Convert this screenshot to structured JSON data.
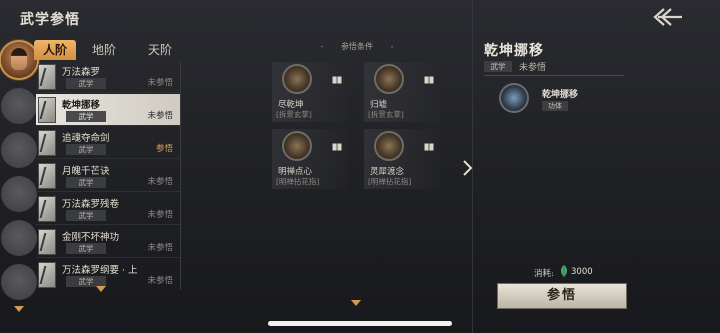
{
  "header": {
    "title": "武学参悟"
  },
  "tabs": [
    {
      "label": "人阶",
      "active": true
    },
    {
      "label": "地阶",
      "active": false
    },
    {
      "label": "天阶",
      "active": false
    }
  ],
  "skills": [
    {
      "name": "万法森罗",
      "tag": "武学",
      "status": "未参悟",
      "selected": false,
      "status_color": "gray"
    },
    {
      "name": "乾坤挪移",
      "tag": "武学",
      "status": "未参悟",
      "selected": true,
      "status_color": "dark"
    },
    {
      "name": "追魂夺命剑",
      "tag": "武学",
      "status": "参悟",
      "selected": false,
      "status_color": "gold"
    },
    {
      "name": "月魄千芒诀",
      "tag": "武学",
      "status": "未参悟",
      "selected": false,
      "status_color": "gray"
    },
    {
      "name": "万法森罗残卷",
      "tag": "武学",
      "status": "未参悟",
      "selected": false,
      "status_color": "gray"
    },
    {
      "name": "金刚不坏神功",
      "tag": "武学",
      "status": "未参悟",
      "selected": false,
      "status_color": "gray"
    },
    {
      "name": "万法森罗纲要 · 上",
      "tag": "武学",
      "status": "未参悟",
      "selected": false,
      "status_color": "gray"
    }
  ],
  "conditions": {
    "title": "参悟条件",
    "items": [
      {
        "name": "尽乾坤",
        "sub": "[拆景玄掌]"
      },
      {
        "name": "归墟",
        "sub": "[拆景玄掌]"
      },
      {
        "name": "明禅点心",
        "sub": "[明禅拈花指]"
      },
      {
        "name": "灵犀渡念",
        "sub": "[明禅拈花指]"
      }
    ]
  },
  "detail": {
    "title": "乾坤挪移",
    "tag": "武学",
    "status": "未参悟",
    "sub_skill": {
      "name": "乾坤挪移",
      "tag": "功体"
    },
    "cost_label": "消耗:",
    "cost_value": "3000",
    "action_label": "参悟"
  },
  "colors": {
    "accent": "#d18f43",
    "gold": "#d2a055",
    "background": "#1f2024"
  }
}
